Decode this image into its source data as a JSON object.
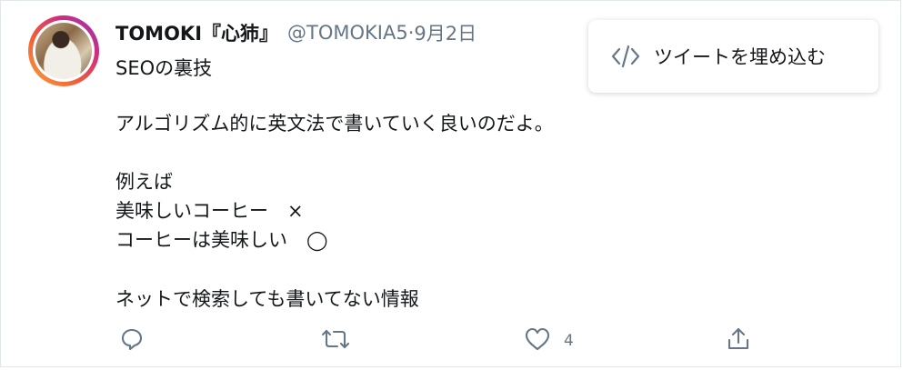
{
  "tweet": {
    "author": {
      "name": "TOMOKI『心犻』",
      "handle": "@TOMOKIA5",
      "separator": " · ",
      "date": "9月2日"
    },
    "subtitle": "SEOの裏技",
    "lines": [
      "アルゴリズム的に英文法で書いていく良いのだよ。",
      "例えば",
      "美味しいコーヒー　×",
      "コーヒーは美味しい　◯",
      "ネットで検索しても書いてない情報"
    ],
    "actions": {
      "like_count": "4"
    }
  },
  "embed_menu": {
    "label": "ツイートを埋め込む"
  },
  "icons": {
    "reply": "reply-icon",
    "retweet": "retweet-icon",
    "like": "heart-icon",
    "share": "share-icon",
    "embed": "code-icon"
  },
  "colors": {
    "text": "#14171a",
    "muted": "#657786",
    "border": "#e1e8ed"
  }
}
